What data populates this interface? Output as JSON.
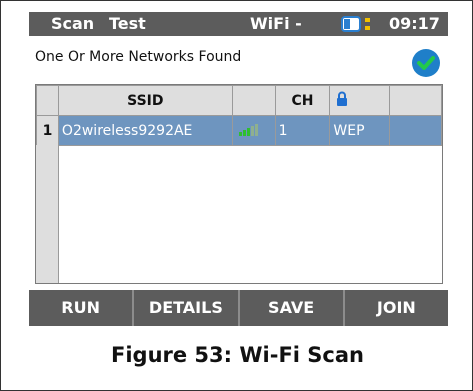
{
  "statusbar": {
    "scan": "Scan",
    "test": "Test",
    "wifi": "WiFi -",
    "time": "09:17"
  },
  "header": {
    "message": "One Or More Networks Found"
  },
  "table": {
    "headers": {
      "ssid": "SSID",
      "signal": "",
      "ch": "CH",
      "security_icon": "lock-icon",
      "extra": ""
    },
    "rows": [
      {
        "row_number": "1",
        "ssid": "O2wireless9292AE",
        "signal_icon": "signal-strength-icon",
        "signal_level": "3 of 5 bars",
        "ch": "1",
        "security": "WEP"
      }
    ]
  },
  "buttons": {
    "run": "RUN",
    "details": "DETAILS",
    "save": "SAVE",
    "join": "JOIN"
  },
  "caption": "Figure 53: Wi-Fi Scan",
  "colors": {
    "statusbar_bg": "#5c5c5c",
    "selected_row": "#6e95bf",
    "header_cell": "#dedede",
    "check_blue": "#1f7fc9",
    "signal_green": "#2fbf2f",
    "battery_yellow": "#f2c200"
  }
}
